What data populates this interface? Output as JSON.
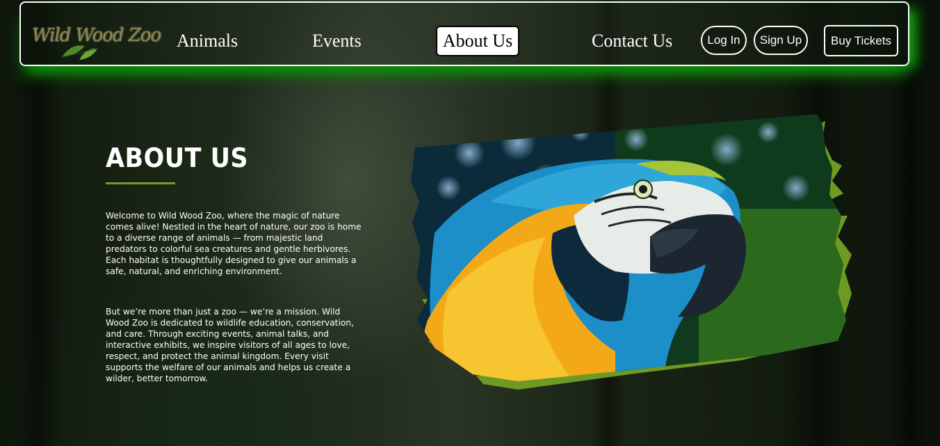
{
  "logo": {
    "text": "Wild Wood Zoo"
  },
  "nav": {
    "links": [
      "Animals",
      "Events",
      "About Us",
      "Contact Us"
    ],
    "active": "About Us",
    "login_label": "Log In",
    "signup_label": "Sign Up",
    "tickets_label": "Buy Tickets"
  },
  "about": {
    "title": "ABOUT US",
    "paragraph1": "Welcome to Wild Wood Zoo, where the magic of nature comes alive! Nestled in the heart of nature, our zoo is home to a diverse range of animals — from majestic land predators to colorful sea creatures and gentle herbivores. Each habitat is thoughtfully designed to give our animals a safe, natural, and enriching environment.",
    "paragraph2": "But we’re more than just a zoo — we’re a mission. Wild Wood Zoo is dedicated to wildlife education, conservation, and care. Through exciting events, animal talks, and interactive exhibits, we inspire visitors of all ages to love, respect, and protect the animal kingdom. Every visit supports the welfare of our animals and helps us create a wilder, better tomorrow."
  },
  "colors": {
    "accent_green": "#7a9a2e",
    "nav_glow": "#13a80e",
    "text": "#ffffff"
  }
}
